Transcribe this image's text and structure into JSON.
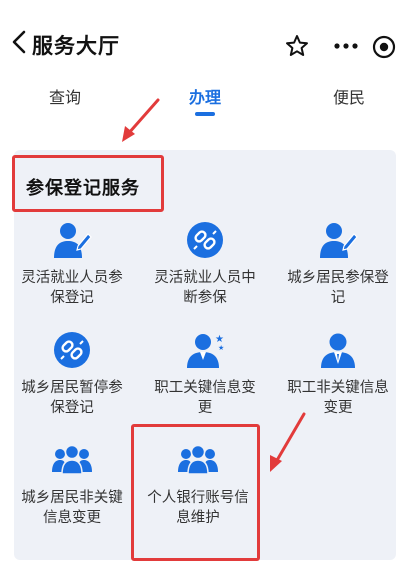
{
  "header": {
    "title": "服务大厅"
  },
  "tabs": [
    {
      "label": "查询"
    },
    {
      "label": "办理"
    },
    {
      "label": "便民"
    }
  ],
  "section": {
    "title": "参保登记服务"
  },
  "items": [
    {
      "label": "灵活就业人员参保登记",
      "icon": "person-pen-icon"
    },
    {
      "label": "灵活就业人员中断参保",
      "icon": "broken-link-icon"
    },
    {
      "label": "城乡居民参保登记",
      "icon": "person-pen-icon"
    },
    {
      "label": "城乡居民暂停参保登记",
      "icon": "broken-link-icon"
    },
    {
      "label": "职工关键信息变更",
      "icon": "person-star-icon"
    },
    {
      "label": "职工非关键信息变更",
      "icon": "person-tie-icon"
    },
    {
      "label": "城乡居民非关键信息变更",
      "icon": "group-icon"
    },
    {
      "label": "个人银行账号信息维护",
      "icon": "group-icon"
    }
  ],
  "colors": {
    "accent": "#1b6fe0",
    "highlight": "#e23b3b",
    "panel": "#eef1f7"
  }
}
